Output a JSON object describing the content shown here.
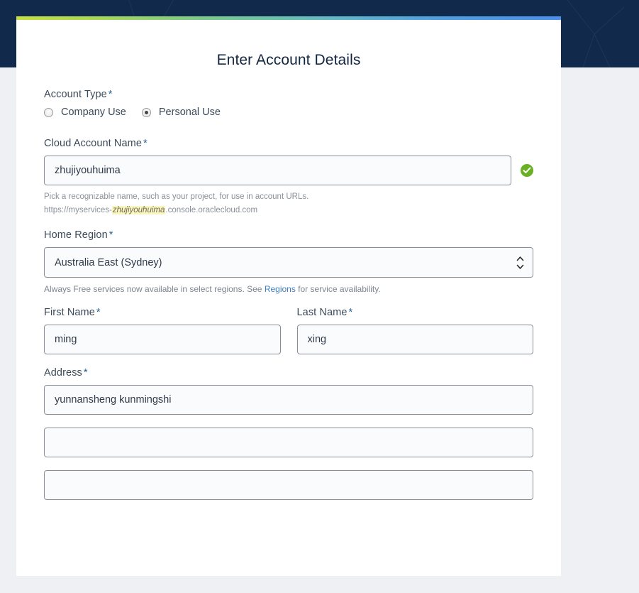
{
  "page": {
    "title": "Enter Account Details",
    "required_marker": "*"
  },
  "theme": {
    "nav_background": "#11294a",
    "page_background": "#eef0f4",
    "card_background": "#ffffff",
    "accent_gradient_start": "#c6e03d",
    "accent_gradient_mid": "#63b9c6",
    "accent_gradient_end": "#4a90ec",
    "link_color": "#3f7fc1",
    "valid_badge_color": "#6ab023",
    "highlight_color": "#fbf5c0"
  },
  "form": {
    "account_type": {
      "label": "Account Type",
      "options": [
        {
          "label": "Company Use",
          "selected": false
        },
        {
          "label": "Personal Use",
          "selected": true
        }
      ]
    },
    "cloud_account_name": {
      "label": "Cloud Account Name",
      "value": "zhujiyouhuima",
      "placeholder": "",
      "validation_icon": "check-circle-icon",
      "helper_line1": "Pick a recognizable name, such as your project, for use in account URLs.",
      "url_prefix": "https://myservices-",
      "url_highlight": "zhujiyouhuima",
      "url_suffix": ".console.oraclecloud.com"
    },
    "home_region": {
      "label": "Home Region",
      "value": "Australia East (Sydney)",
      "options": [
        "Australia East (Sydney)"
      ],
      "helper_prefix": "Always Free services now available in select regions. See ",
      "helper_link": "Regions",
      "helper_suffix": " for service availability."
    },
    "first_name": {
      "label": "First Name",
      "value": "ming",
      "placeholder": ""
    },
    "last_name": {
      "label": "Last Name",
      "value": "xing",
      "placeholder": ""
    },
    "address": {
      "label": "Address",
      "line1_value": "yunnansheng kunmingshi",
      "line1_placeholder": "",
      "line2_value": "",
      "line2_placeholder": "",
      "line3_value": "",
      "line3_placeholder": ""
    }
  }
}
